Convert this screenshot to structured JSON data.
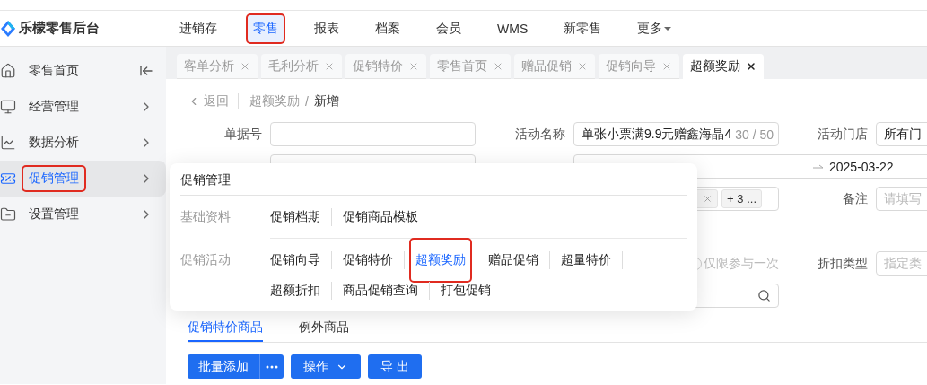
{
  "app": {
    "name": "乐檬零售后台"
  },
  "top_nav": [
    {
      "label": "进销存",
      "kind": "link",
      "selected": false,
      "highlighted": false
    },
    {
      "label": "零售",
      "kind": "link",
      "selected": true,
      "highlighted": true
    },
    {
      "label": "报表",
      "kind": "link",
      "selected": false,
      "highlighted": false
    },
    {
      "label": "档案",
      "kind": "link",
      "selected": false,
      "highlighted": false
    },
    {
      "label": "会员",
      "kind": "link",
      "selected": false,
      "highlighted": false
    },
    {
      "label": "WMS",
      "kind": "link",
      "selected": false,
      "highlighted": false
    },
    {
      "label": "新零售",
      "kind": "link",
      "selected": false,
      "highlighted": false
    },
    {
      "label": "更多",
      "kind": "menu",
      "selected": false,
      "highlighted": false
    }
  ],
  "sidebar": {
    "items": [
      {
        "label": "零售首页",
        "kind": "home",
        "selected": false,
        "highlighted": false
      },
      {
        "label": "经营管理",
        "kind": "group",
        "selected": false,
        "highlighted": false
      },
      {
        "label": "数据分析",
        "kind": "group",
        "selected": false,
        "highlighted": false
      },
      {
        "label": "促销管理",
        "kind": "group",
        "selected": true,
        "highlighted": true
      },
      {
        "label": "设置管理",
        "kind": "group",
        "selected": false,
        "highlighted": false
      }
    ]
  },
  "tabs": [
    {
      "label": "客单分析",
      "selected": false
    },
    {
      "label": "毛利分析",
      "selected": false
    },
    {
      "label": "促销特价",
      "selected": false
    },
    {
      "label": "零售首页",
      "selected": false
    },
    {
      "label": "赠品促销",
      "selected": false
    },
    {
      "label": "促销向导",
      "selected": false
    },
    {
      "label": "超额奖励",
      "selected": true
    }
  ],
  "breadcrumb": {
    "back": "返回",
    "separator": "/",
    "items": [
      "超额奖励",
      "新增"
    ]
  },
  "form": {
    "upper_rows": [
      [
        {
          "kind": "text",
          "label": "单据号"
        },
        {
          "kind": "text",
          "label": "活动名称",
          "value": "单张小票满9.9元赠鑫海晶4",
          "count": "30 / 50"
        },
        {
          "kind": "text",
          "label": "活动门店",
          "value": "所有门"
        }
      ],
      [
        {
          "kind": "blank"
        },
        {
          "kind": "daterange",
          "end": "2025-03-22"
        }
      ],
      [
        {
          "kind": "hidden"
        },
        {
          "kind": "tags",
          "tags": [
            {
              "closable": true
            },
            {
              "label": "+ 3 ...",
              "closable": false
            }
          ]
        },
        {
          "kind": "placeholder",
          "label": "备注",
          "placeholder": "请填写"
        }
      ]
    ],
    "lower_rows": [
      [
        {
          "kind": "hidden"
        },
        {
          "kind": "checkbox",
          "text": "仅限参与一次",
          "checked": false
        },
        {
          "kind": "placeholder",
          "label": "折扣类型",
          "placeholder": "指定类"
        }
      ],
      [
        {
          "kind": "hidden"
        },
        {
          "kind": "search"
        }
      ]
    ]
  },
  "goods_tabs": [
    {
      "label": "促销特价商品",
      "selected": true
    },
    {
      "label": "例外商品",
      "selected": false
    }
  ],
  "actions": [
    {
      "label": "批量添加",
      "kind": "split"
    },
    {
      "label": "操作",
      "kind": "dropdown"
    },
    {
      "label": "导 出",
      "kind": "plain"
    }
  ],
  "menu_popup": {
    "title": "促销管理",
    "sections": [
      {
        "label": "基础资料",
        "items": [
          {
            "label": "促销档期",
            "selected": false,
            "highlighted": false
          },
          {
            "label": "促销商品模板",
            "selected": false,
            "highlighted": false
          }
        ]
      },
      {
        "label": "促销活动",
        "items": [
          {
            "label": "促销向导",
            "selected": false,
            "highlighted": false
          },
          {
            "label": "促销特价",
            "selected": false,
            "highlighted": false
          },
          {
            "label": "超额奖励",
            "selected": true,
            "highlighted": true
          },
          {
            "label": "赠品促销",
            "selected": false,
            "highlighted": false
          },
          {
            "label": "超量特价",
            "selected": false,
            "highlighted": false
          },
          {
            "label": "超额折扣",
            "selected": false,
            "highlighted": false
          },
          {
            "label": "商品促销查询",
            "selected": false,
            "highlighted": false
          },
          {
            "label": "打包促销",
            "selected": false,
            "highlighted": false
          }
        ]
      }
    ]
  }
}
